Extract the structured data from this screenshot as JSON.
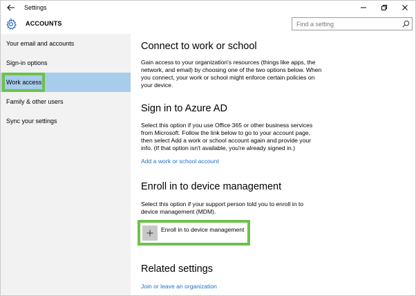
{
  "window": {
    "title": "Settings",
    "controls": [
      "minimize",
      "restore",
      "close"
    ]
  },
  "header": {
    "title": "ACCOUNTS",
    "icon": "gear-icon",
    "accent": "#2a6bbf"
  },
  "search": {
    "placeholder": "Find a setting",
    "value": ""
  },
  "sidebar": {
    "items": [
      {
        "label": "Your email and accounts",
        "selected": false
      },
      {
        "label": "Sign-in options",
        "selected": false
      },
      {
        "label": "Work access",
        "selected": true
      },
      {
        "label": "Family & other users",
        "selected": false
      },
      {
        "label": "Sync your settings",
        "selected": false
      }
    ]
  },
  "main": {
    "section1": {
      "title": "Connect to work or school",
      "body": "Gain access to your organization's resources (things like apps, the network, and email) by choosing one of the two options below. When you connect, your work or school might enforce certain policies on your device."
    },
    "section2": {
      "title": "Sign in to Azure AD",
      "body": "Select this option if you use Office 365 or other business services from Microsoft. Follow the link below to go to your account page, then select Add a work or school account again and provide your info. (If that option isn't available, you're already signed in.)",
      "link": "Add a work or school account"
    },
    "section3": {
      "title": "Enroll in to device management",
      "body": "Select this option if your support person told you to enroll in to device management (MDM).",
      "button_label": "Enroll in to device management"
    },
    "section4": {
      "title": "Related settings",
      "link": "Join or leave an organization"
    }
  },
  "colors": {
    "highlight": "#6cc24a",
    "selected_nav": "#a8ccec",
    "link": "#1e6fc8",
    "sidebar_bg": "#f2f2f2"
  }
}
